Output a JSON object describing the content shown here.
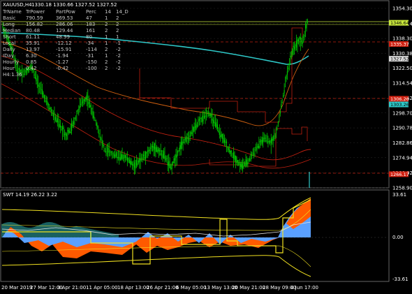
{
  "header": {
    "symbol_tf": "XAUUSD,H4",
    "ohlc": "1330.18 1330.66 1327.52 1327.52"
  },
  "table": {
    "headers": [
      "TrName",
      "TrPower",
      "PartPow",
      "Perc",
      "14",
      "14_D"
    ],
    "rows": [
      {
        "name": "Basic",
        "power": "790.59",
        "part": "369.53",
        "perc": "47",
        "c14": "1",
        "d14": "2"
      },
      {
        "name": "Long",
        "power": "156.82",
        "part": "286.06",
        "perc": "183",
        "c14": "2",
        "d14": "2"
      },
      {
        "name": "Median",
        "power": "80.48",
        "part": "129.44",
        "perc": "161",
        "c14": "2",
        "d14": "2"
      },
      {
        "name": "Short",
        "power": "61.11",
        "part": "48.99",
        "perc": "80",
        "c14": "1",
        "d14": "1"
      },
      {
        "name": "Local",
        "power": "35.91",
        "part": "-12.12",
        "perc": "-34",
        "c14": "1",
        "d14": "-1"
      },
      {
        "name": "Daily",
        "power": "13.97",
        "part": "-15.91",
        "perc": "-114",
        "c14": "2",
        "d14": "-2"
      },
      {
        "name": "IDay",
        "power": "6.30",
        "part": "-1.94",
        "perc": "-31",
        "c14": "1",
        "d14": "-2"
      },
      {
        "name": "Hourly",
        "power": "0.85",
        "part": "-1.27",
        "perc": "-150",
        "c14": "2",
        "d14": "-2"
      },
      {
        "name": "Hour",
        "power": "0.42",
        "part": "-0.42",
        "perc": "-100",
        "c14": "2",
        "d14": "-2"
      }
    ],
    "footer": "H4:1.36"
  },
  "price_axis": {
    "ticks": [
      "1354.30",
      "1346.14",
      "1338.30",
      "1330.38",
      "1322.50",
      "1314.54",
      "1306.62",
      "1298.70",
      "1290.78",
      "1282.86",
      "1274.94",
      "1266.92",
      "1258.90"
    ],
    "tags": [
      {
        "value": "1346.64",
        "color": "#c8e63c",
        "text_color": "#000"
      },
      {
        "value": "1335.37",
        "color": "#d02010",
        "text_color": "#fff"
      },
      {
        "value": "1327.52",
        "color": "#d8d8d8",
        "text_color": "#000"
      },
      {
        "value": "1306.26",
        "color": "#d02010",
        "text_color": "#fff"
      },
      {
        "value": "1303.26",
        "color": "#2ec8c8",
        "text_color": "#000"
      },
      {
        "value": "1266.17",
        "color": "#d02010",
        "text_color": "#fff"
      }
    ]
  },
  "sub": {
    "title": "SWT 14.19 26.22 3.22",
    "axis_ticks": [
      "33.61",
      "0.00",
      "-33.61"
    ]
  },
  "time_axis": {
    "labels": [
      "20 Mar 2019",
      "27 Mar 12:00",
      "3 Apr 21:00",
      "11 Apr 05:00",
      "18 Apr 13:00",
      "26 Apr 21:00",
      "6 May 05:00",
      "13 May 13:00",
      "20 May 21:00",
      "28 May 09:00",
      "4 Jun 17:00"
    ]
  },
  "colors": {
    "candles": "#00c800",
    "ma_cyan": "#2ec8c8",
    "ma_orange": "#d06010",
    "ma_red": "#c02010",
    "level_yellow": "#c8e63c",
    "hist_orange": "#ff5a00",
    "hist_blue": "#5aa0ff",
    "hist_teal": "#2aa0a0",
    "env_yellow": "#f0e020",
    "grid": "#404040"
  }
}
